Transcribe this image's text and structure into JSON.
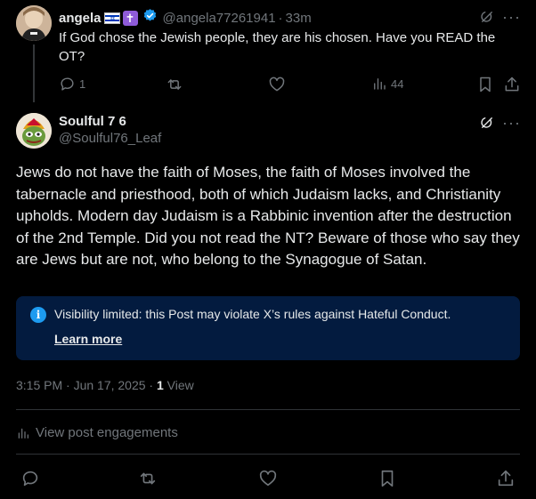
{
  "reply_parent": {
    "display_name": "angela",
    "flag_emoji": "🇮🇱",
    "cross_emoji": "✝",
    "handle": "@angela77261941",
    "time": "33m",
    "text": "If God chose the Jewish people, they are his chosen. Have you READ the OT?",
    "reply_count": "1",
    "views": "44"
  },
  "main_post": {
    "display_name": "Soulful 7 6",
    "handle": "@Soulful76_Leaf",
    "text": "Jews do not have the faith of Moses, the faith of Moses involved the tabernacle and priesthood, both of which Judaism lacks, and Christianity upholds. Modern day Judaism is a Rabbinic invention after the destruction of the 2nd Temple. Did you not read the NT? Beware of those who say they are Jews but are not, who belong to the Synagogue of Satan.",
    "notice_text": "Visibility limited: this Post may violate X’s rules against Hateful Conduct.",
    "learn_more": "Learn more",
    "timestamp": "3:15 PM · Jun 17, 2025 · ",
    "view_count": "1",
    "view_label": "View",
    "engagements": "View post engagements"
  },
  "colors": {
    "background": "#000000",
    "text": "#e7e9ea",
    "muted": "#71767b",
    "accent": "#1d9bf0",
    "notice_bg": "#031b3f"
  }
}
